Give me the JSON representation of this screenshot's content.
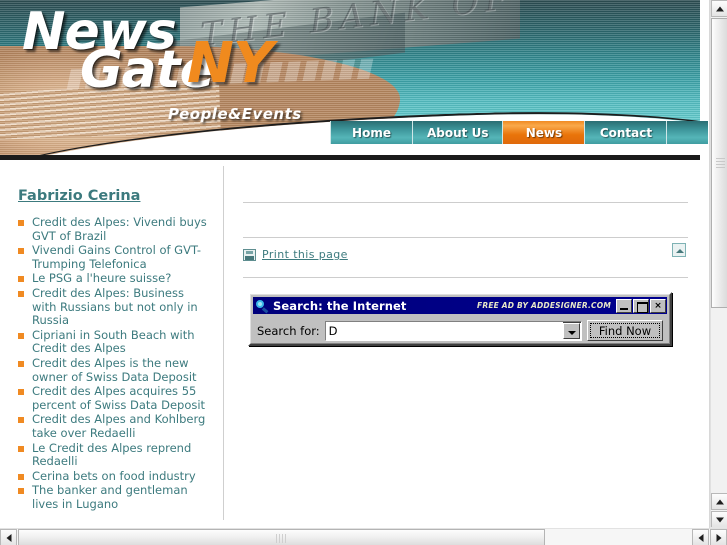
{
  "site": {
    "logo_line1": "News",
    "logo_line2": "Gate",
    "logo_accent": "NY",
    "tagline": "People&Events",
    "banner_engraving": "THE BANK OF"
  },
  "nav": {
    "items": [
      {
        "label": "Home",
        "active": false
      },
      {
        "label": "About Us",
        "active": false
      },
      {
        "label": "News",
        "active": true
      },
      {
        "label": "Contact",
        "active": false
      }
    ]
  },
  "sidebar": {
    "title": "Fabrizio Cerina",
    "items": [
      "Credit des Alpes: Vivendi buys GVT of Brazil",
      "Vivendi Gains Control of GVT-Trumping Telefonica",
      "Le PSG a l'heure suisse?",
      "Credit des Alpes: Business with Russians but not only in Russia",
      "Cipriani in South Beach with Credit des Alpes",
      "Credit des Alpes is the new owner of Swiss Data Deposit",
      "Credit des Alpes acquires 55 percent of Swiss Data Deposit",
      "Credit des Alpes and Kohlberg take over Redaelli",
      "Le Credit des Alpes reprend Redaelli",
      "Cerina bets on food industry",
      "The banker and gentleman lives in Lugano"
    ]
  },
  "main": {
    "print_label": "Print this page",
    "print_icon": "printer-icon",
    "back_to_top_icon": "scroll-to-top-icon"
  },
  "search_dialog": {
    "title": "Search: the Internet",
    "title_icon": "magnifier-icon",
    "ad_text": "FREE AD BY ADDESIGNER.COM",
    "minimize_label": "",
    "maximize_label": "",
    "close_label": "×",
    "field_label": "Search for:",
    "field_value": "D",
    "field_placeholder": "",
    "submit_label": "Find Now"
  },
  "scrollbars": {
    "v_up_icon": "arrow-up-icon",
    "v_down_icon": "arrow-down-icon",
    "h_left_icon": "arrow-left-icon",
    "h_right_icon": "arrow-right-icon"
  },
  "colors": {
    "teal": "#3C7A7E",
    "nav_teal": "#3E969B",
    "accent_orange": "#F08A22",
    "dialog_title_blue": "#00007B",
    "dialog_face": "#C0C0C0"
  }
}
